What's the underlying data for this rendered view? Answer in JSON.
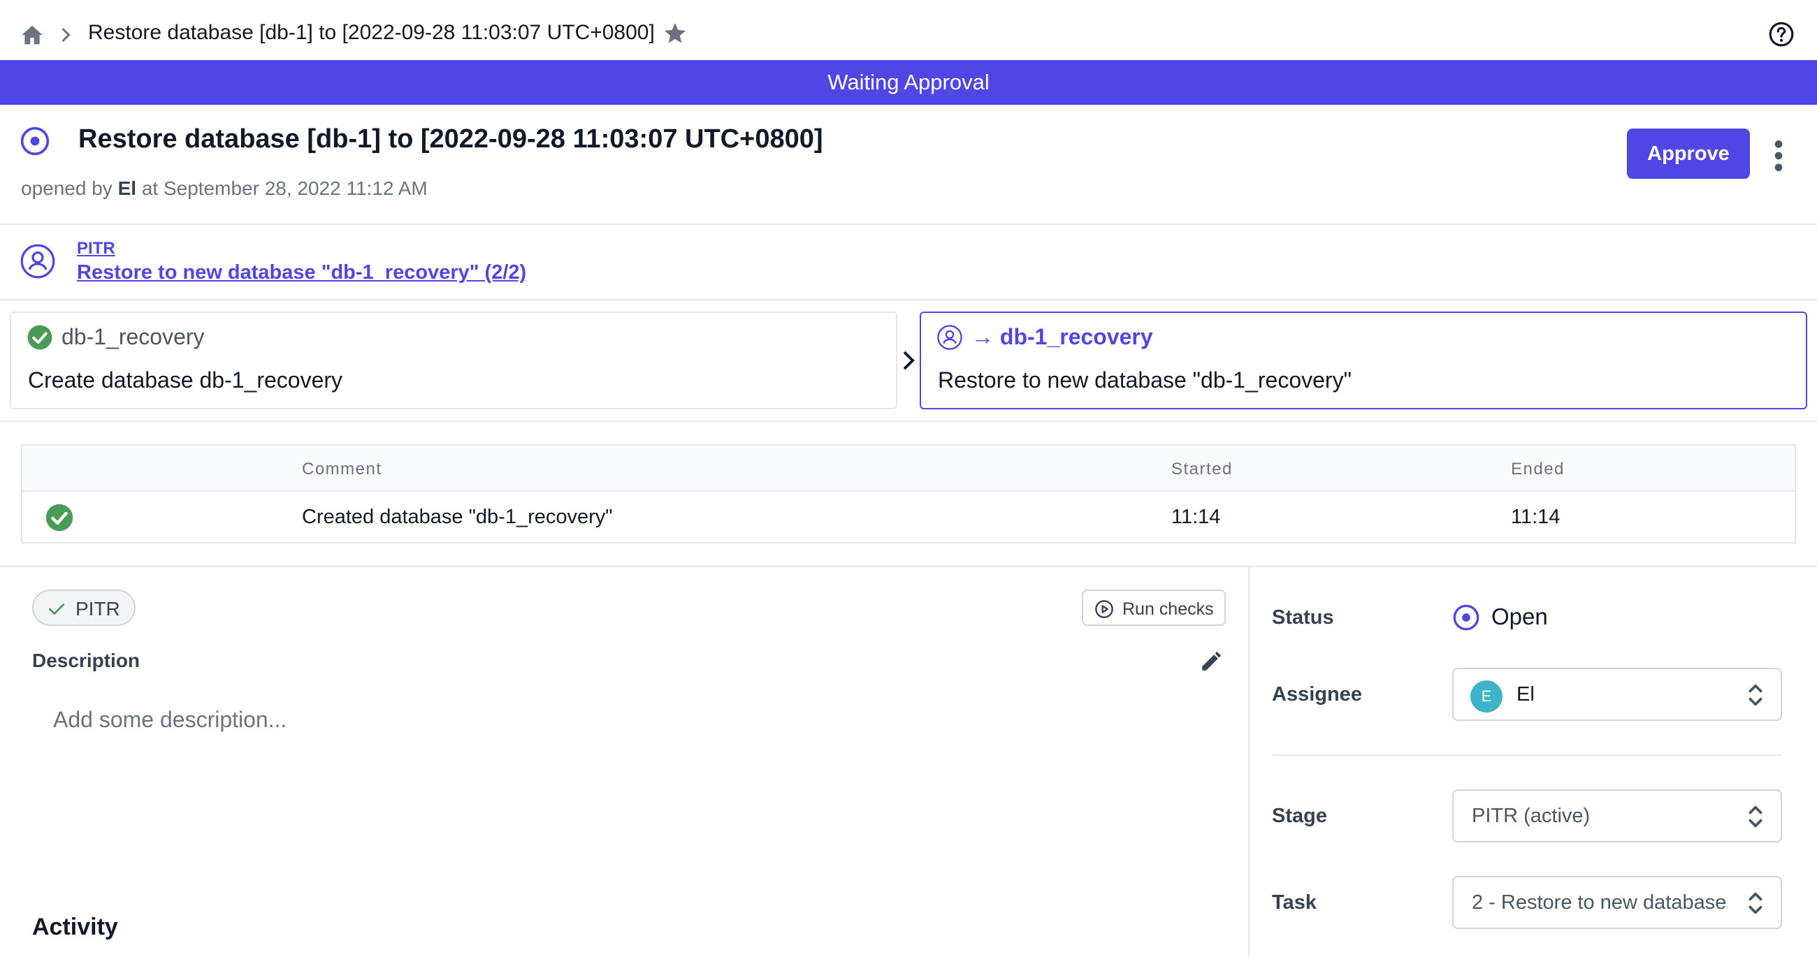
{
  "breadcrumb": {
    "title": "Restore database [db-1] to [2022-09-28 11:03:07 UTC+0800]"
  },
  "banner": {
    "text": "Waiting Approval",
    "color": "#4f46e5"
  },
  "header": {
    "title": "Restore database [db-1] to [2022-09-28 11:03:07 UTC+0800]",
    "opened_prefix": "opened by",
    "opened_by": "El",
    "opened_at": "at September 28, 2022 11:12 AM",
    "approve_label": "Approve"
  },
  "pipeline": {
    "stage_name": "PITR",
    "task_link": "Restore to new database \"db-1_recovery\" (2/2)"
  },
  "tasks": [
    {
      "name": "db-1_recovery",
      "description": "Create database db-1_recovery",
      "status": "done"
    },
    {
      "name": "→ db-1_recovery",
      "description": "Restore to new database \"db-1_recovery\"",
      "status": "active"
    }
  ],
  "runs": {
    "headers": {
      "comment": "Comment",
      "started": "Started",
      "ended": "Ended"
    },
    "rows": [
      {
        "comment": "Created database \"db-1_recovery\"",
        "started": "11:14",
        "ended": "11:14",
        "status": "success"
      }
    ]
  },
  "checks": {
    "chip_label": "PITR",
    "run_checks_label": "Run checks"
  },
  "description": {
    "label": "Description",
    "placeholder": "Add some description..."
  },
  "activity": {
    "label": "Activity"
  },
  "sidebar": {
    "status_label": "Status",
    "status_value": "Open",
    "assignee_label": "Assignee",
    "assignee_initial": "E",
    "assignee_value": "El",
    "stage_label": "Stage",
    "stage_value": "PITR (active)",
    "task_label": "Task",
    "task_value": "2 - Restore to new database"
  },
  "colors": {
    "accent": "#4f46e5",
    "success": "#4a9b55",
    "avatar": "#3fb3c9"
  }
}
